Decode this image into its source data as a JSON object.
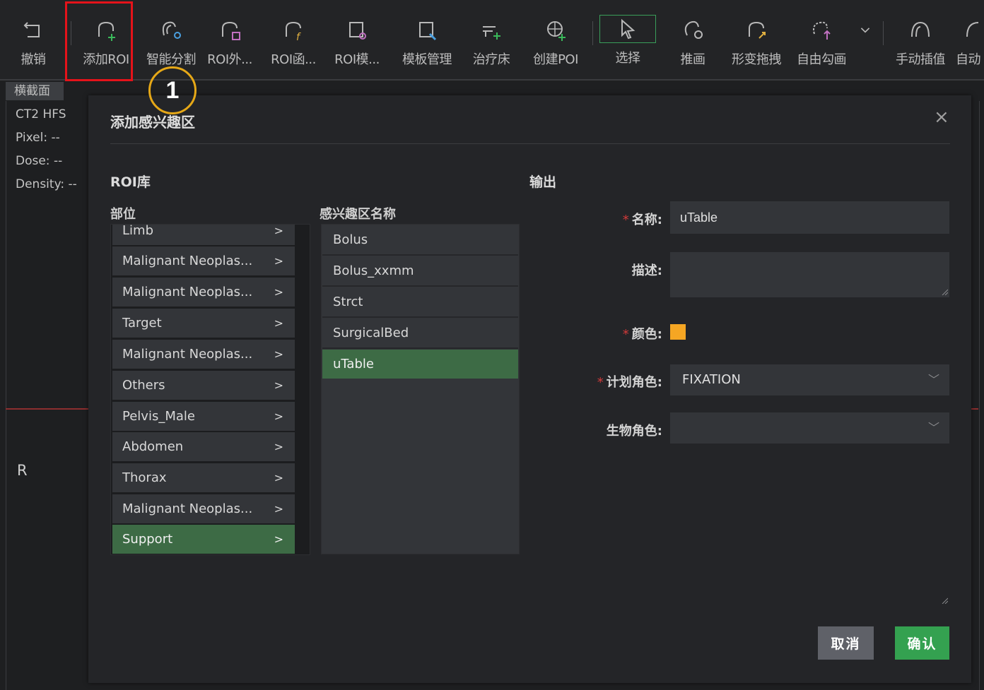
{
  "toolbar": {
    "items": [
      {
        "label": "撤销",
        "icon": "undo-icon"
      },
      {
        "label": "添加ROI",
        "icon": "add-roi-icon"
      },
      {
        "label": "智能分割",
        "icon": "smart-segment-icon"
      },
      {
        "label": "ROI外...",
        "icon": "roi-outer-icon"
      },
      {
        "label": "ROI函...",
        "icon": "roi-function-icon"
      },
      {
        "label": "ROI模...",
        "icon": "roi-template-icon"
      },
      {
        "label": "模板管理",
        "icon": "template-manage-icon"
      },
      {
        "label": "治疗床",
        "icon": "couch-icon"
      },
      {
        "label": "创建POI",
        "icon": "create-poi-icon"
      },
      {
        "label": "选择",
        "icon": "select-cursor-icon"
      },
      {
        "label": "推画",
        "icon": "push-draw-icon"
      },
      {
        "label": "形变拖拽",
        "icon": "deform-drag-icon"
      },
      {
        "label": "自由勾画",
        "icon": "free-draw-icon"
      },
      {
        "label": "手动插值",
        "icon": "manual-interp-icon"
      },
      {
        "label": "自动",
        "icon": "auto-icon"
      }
    ]
  },
  "view": {
    "tab_label": "横截面",
    "info": [
      "CT2 HFS",
      "Pixel: --",
      "Dose: --",
      "Density: --"
    ],
    "orientation": "R"
  },
  "step_badge": "1",
  "dialog": {
    "title": "添加感兴趣区",
    "roi_library_heading": "ROI库",
    "output_heading": "输出",
    "part_heading": "部位",
    "roi_name_heading": "感兴趣区名称",
    "parts": [
      {
        "label": "Limb",
        "chevron": ">"
      },
      {
        "label": "Malignant Neoplas...",
        "chevron": ">"
      },
      {
        "label": "Malignant Neoplas...",
        "chevron": ">"
      },
      {
        "label": "Target",
        "chevron": ">"
      },
      {
        "label": "Malignant Neoplas...",
        "chevron": ">"
      },
      {
        "label": "Others",
        "chevron": ">"
      },
      {
        "label": "Pelvis_Male",
        "chevron": ">"
      },
      {
        "label": "Abdomen",
        "chevron": ">"
      },
      {
        "label": "Thorax",
        "chevron": ">"
      },
      {
        "label": "Malignant Neoplas...",
        "chevron": ">"
      },
      {
        "label": "Support",
        "chevron": ">"
      }
    ],
    "selected_part": "Support",
    "roi_names": [
      "Bolus",
      "Bolus_xxmm",
      "Strct",
      "SurgicalBed",
      "uTable"
    ],
    "selected_roi": "uTable",
    "form": {
      "required_mark": "*",
      "name_label": "名称:",
      "name_value": "uTable",
      "desc_label": "描述:",
      "desc_value": "",
      "color_label": "颜色:",
      "color_value": "#f5a623",
      "plan_role_label": "计划角色:",
      "plan_role_value": "FIXATION",
      "bio_role_label": "生物角色:",
      "bio_role_value": ""
    },
    "cancel_label": "取消",
    "confirm_label": "确认",
    "close_glyph": "×"
  }
}
